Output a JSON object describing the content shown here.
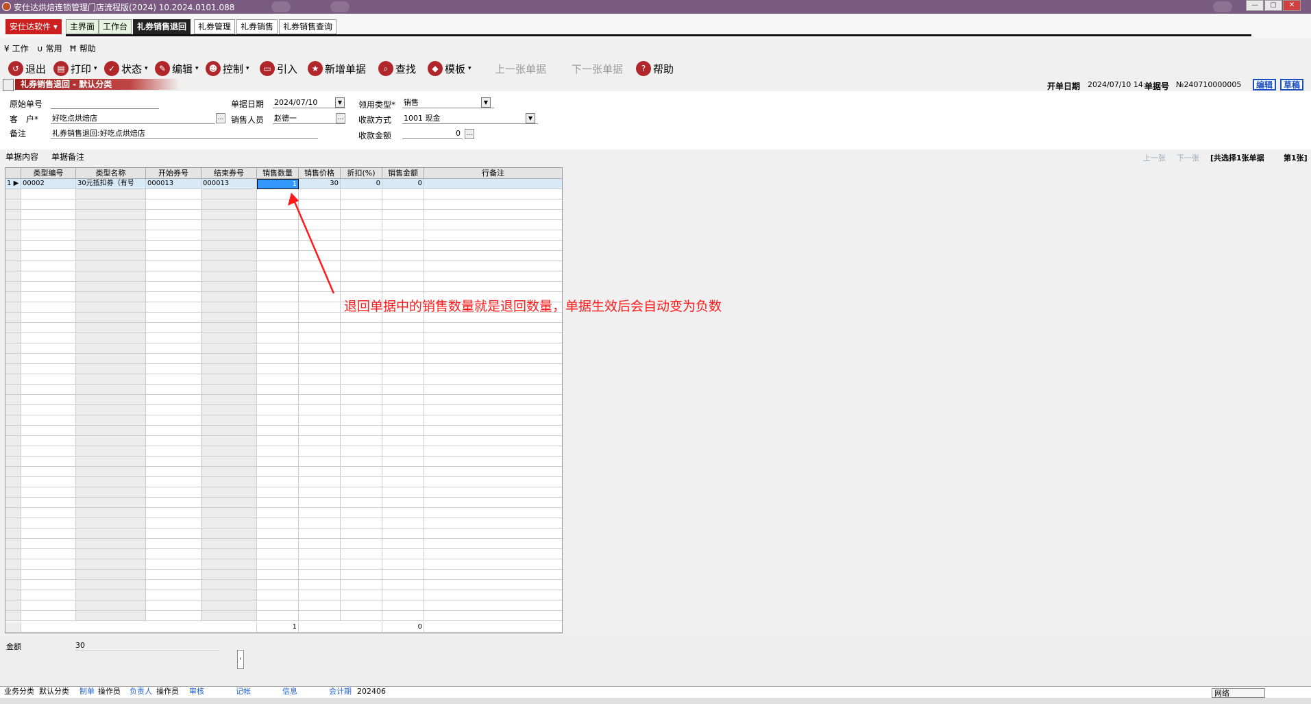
{
  "window": {
    "title": "安仕达烘焙连锁管理门店流程版(2024)    10.2024.0101.088",
    "min": "—",
    "max": "▢",
    "close": "✕"
  },
  "brand": {
    "label": "安仕达软件"
  },
  "tabs": [
    {
      "label": "主界面"
    },
    {
      "label": "工作台"
    },
    {
      "label": "礼券销售退回"
    },
    {
      "label": "礼券管理"
    },
    {
      "label": "礼券销售"
    },
    {
      "label": "礼券销售查询"
    }
  ],
  "menu": {
    "work": "工作",
    "common": "常用",
    "help": "帮助"
  },
  "toolbar": {
    "exit": "退出",
    "print": "打印",
    "status": "状态",
    "edit": "编辑",
    "control": "控制",
    "import": "引入",
    "new": "新增单据",
    "find": "查找",
    "template": "模板",
    "prev": "上一张单据",
    "next": "下一张单据",
    "help": "帮助"
  },
  "header": {
    "title": "礼券销售退回 - 默认分类",
    "open_date_label": "开单日期",
    "open_date": "2024/07/10 14:",
    "doc_no_label": "单据号",
    "doc_no": "№240710000005",
    "edit_btn": "编辑",
    "draft_btn": "草稿"
  },
  "form": {
    "orig_no_label": "原始单号",
    "orig_no": "",
    "customer_label": "客　户*",
    "customer": "好吃点烘焙店",
    "remark_label": "备注",
    "remark": "礼券销售退回:好吃点烘焙店",
    "date_label": "单据日期",
    "date": "2024/07/10",
    "sales_label": "销售人员",
    "sales": "赵德一",
    "use_type_label": "领用类型*",
    "use_type": "销售",
    "pay_label": "收款方式",
    "pay": "1001  现金",
    "amount_label": "收款金额",
    "amount": "0"
  },
  "subtabs": {
    "content": "单据内容",
    "remark": "单据备注"
  },
  "nav": {
    "prev": "上一张",
    "next": "下一张",
    "count": "[共选择1张单据",
    "page": "第1张]"
  },
  "grid": {
    "columns": [
      "类型编号",
      "类型名称",
      "开始券号",
      "结束券号",
      "销售数量",
      "销售价格",
      "折扣(%)",
      "销售金额",
      "行备注"
    ],
    "rows": [
      {
        "num": "1",
        "type_code": "00002",
        "type_name": "30元抵扣券（有号",
        "start_no": "000013",
        "end_no": "000013",
        "qty": "1",
        "price": "30",
        "discount": "0",
        "amount": "0",
        "note": ""
      }
    ],
    "totals": {
      "qty": "1",
      "amount": "0"
    }
  },
  "footer": {
    "amount_label": "金额",
    "amount_value": "30"
  },
  "statusbar": {
    "biz_label": "业务分类",
    "biz_value": "默认分类",
    "maker_label": "制单",
    "maker_value": "操作员",
    "owner_label": "负责人",
    "owner_value": "操作员",
    "audit_label": "审核",
    "post_label": "记帐",
    "info_label": "信息",
    "period_label": "会计期",
    "period_value": "202406",
    "network": "网络"
  },
  "annotation": "退回单据中的销售数量就是退回数量，单据生效后会自动变为负数",
  "colors": {
    "accent": "#b0262b",
    "annotation": "#ff1a1a",
    "selection": "#3399ff",
    "title_bar": "#7a5a80"
  }
}
